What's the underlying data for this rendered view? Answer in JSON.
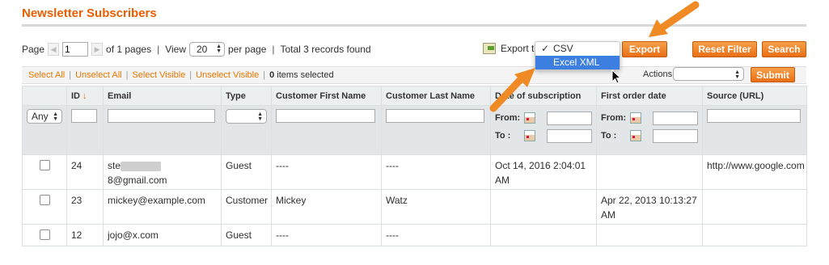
{
  "page": {
    "title": "Newsletter Subscribers"
  },
  "pager": {
    "page_label": "Page",
    "page_value": "1",
    "of_pages": "of 1 pages",
    "view_label": "View",
    "view_value": "20",
    "per_page": "per page",
    "records": "Total 3 records found",
    "export_label": "Export to:"
  },
  "export_menu": {
    "options": [
      {
        "label": "CSV",
        "checked": true
      },
      {
        "label": "Excel XML",
        "highlighted": true
      }
    ]
  },
  "buttons": {
    "export": "Export",
    "reset_filter": "Reset Filter",
    "search": "Search",
    "submit": "Submit"
  },
  "massaction": {
    "select_all": "Select All",
    "unselect_all": "Unselect All",
    "select_visible": "Select Visible",
    "unselect_visible": "Unselect Visible",
    "items_count": "0",
    "items_selected": "items selected",
    "actions_label": "Actions"
  },
  "grid": {
    "columns": [
      "",
      "ID",
      "Email",
      "Type",
      "Customer First Name",
      "Customer Last Name",
      "Date of subscription",
      "First order date",
      "Source (URL)"
    ],
    "filter": {
      "any": "Any",
      "from": "From:",
      "to": "To :"
    },
    "rows": [
      {
        "id": "24",
        "email_start": "ste",
        "email_end": "8@gmail.com",
        "type": "Guest",
        "first": "----",
        "last": "----",
        "subscribed": "Oct 14, 2016 2:04:01 AM",
        "first_order": "",
        "source": "http://www.google.com"
      },
      {
        "id": "23",
        "email": "mickey@example.com",
        "type": "Customer",
        "first": "Mickey",
        "last": "Watz",
        "subscribed": "",
        "first_order": "Apr 22, 2013 10:13:27 AM",
        "source": ""
      },
      {
        "id": "12",
        "email": "jojo@x.com",
        "type": "Guest",
        "first": "----",
        "last": "----",
        "subscribed": "",
        "first_order": "",
        "source": ""
      }
    ]
  },
  "colors": {
    "accent": "#eb5e00",
    "button": "#e96f14",
    "link": "#ea7601",
    "highlight": "#3d7fe0",
    "callout": "#f08a24"
  }
}
